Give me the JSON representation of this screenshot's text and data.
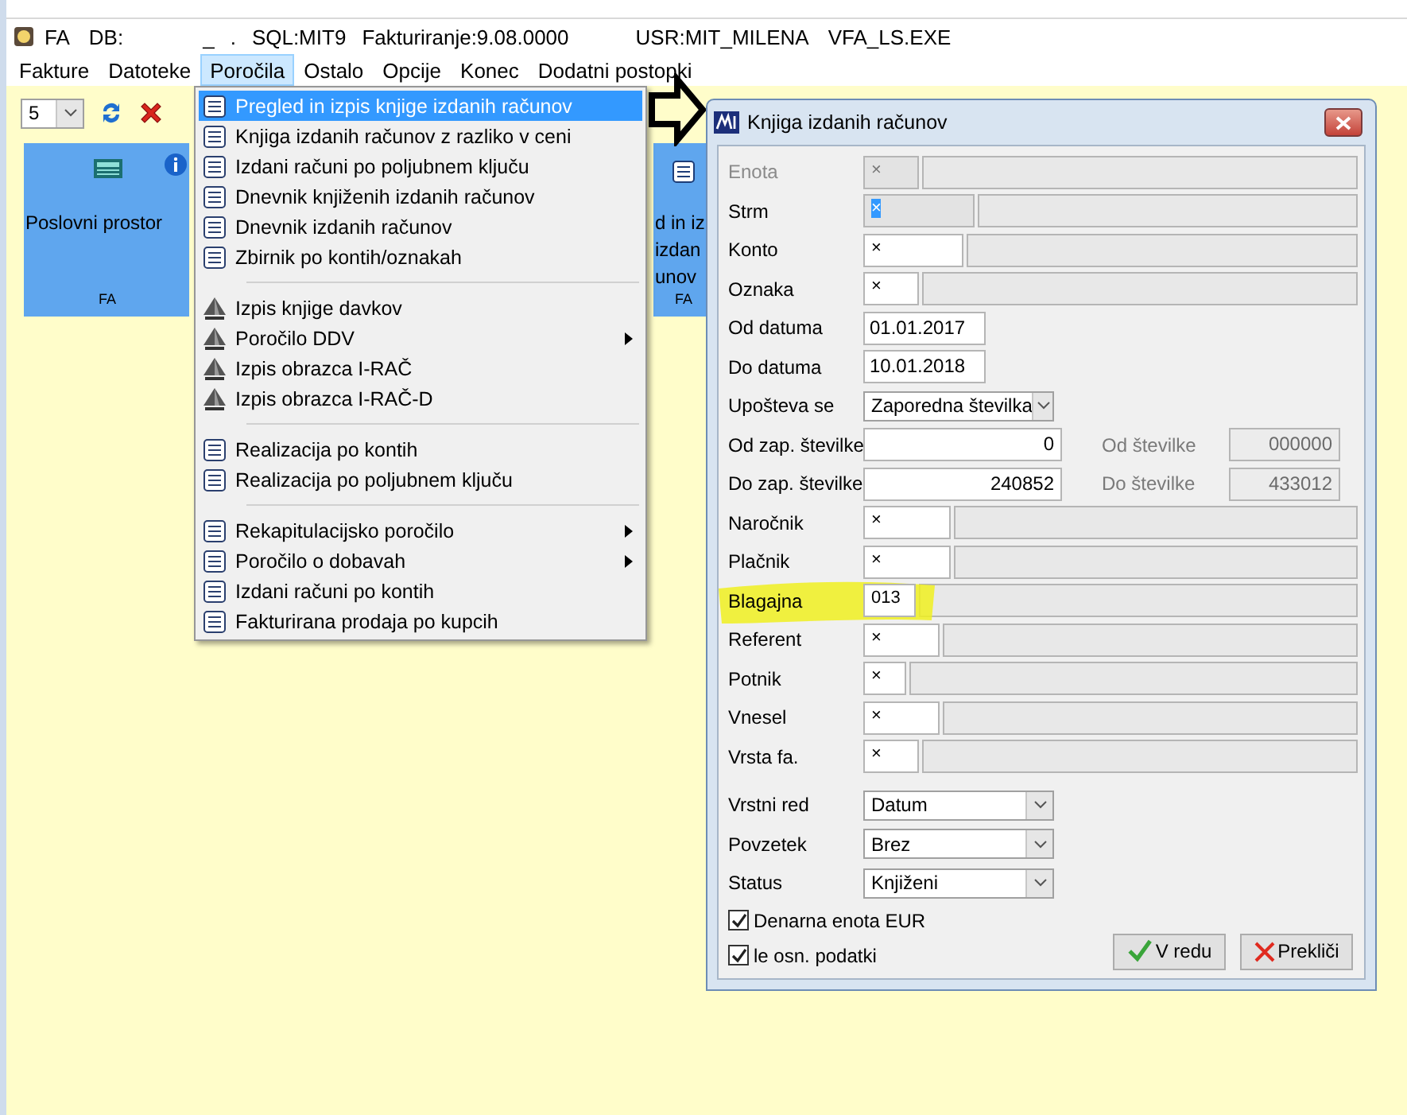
{
  "app_title": {
    "items": [
      "FA",
      "DB:",
      "_",
      ".",
      "SQL:MIT9",
      "Fakturiranje:9.08.0000",
      "USR:MIT_MILENA",
      "VFA_LS.EXE"
    ]
  },
  "menu_bar": [
    {
      "label": "Fakture",
      "selected": false
    },
    {
      "label": "Datoteke",
      "selected": false
    },
    {
      "label": "Poročila",
      "selected": true
    },
    {
      "label": "Ostalo",
      "selected": false
    },
    {
      "label": "Opcije",
      "selected": false
    },
    {
      "label": "Konec",
      "selected": false
    },
    {
      "label": "Dodatni postopki",
      "selected": false
    }
  ],
  "toolbar": {
    "count_select": "5"
  },
  "tiles": [
    {
      "title_lines": [
        "Poslovni prostor"
      ],
      "code": "FA",
      "kind": "calculator"
    },
    {
      "title_lines": [
        "d in iz",
        "izdan",
        "unov"
      ],
      "code": "FA",
      "kind": "report"
    }
  ],
  "dropdown_menu": {
    "groups": [
      [
        {
          "label": "Pregled in izpis knjige izdanih računov",
          "kind": "report",
          "submenu": false,
          "selected": true
        },
        {
          "label": "Knjiga izdanih računov z razliko v ceni",
          "kind": "report",
          "submenu": false,
          "selected": false
        },
        {
          "label": "Izdani računi po poljubnem ključu",
          "kind": "report",
          "submenu": false,
          "selected": false
        },
        {
          "label": "Dnevnik knjiženih izdanih računov",
          "kind": "report",
          "submenu": false,
          "selected": false
        },
        {
          "label": "Dnevnik izdanih računov",
          "kind": "report",
          "submenu": false,
          "selected": false
        },
        {
          "label": "Zbirnik po kontih/oznakah",
          "kind": "report",
          "submenu": false,
          "selected": false
        }
      ],
      [
        {
          "label": "Izpis knjige davkov",
          "kind": "tax",
          "submenu": false,
          "selected": false
        },
        {
          "label": "Poročilo DDV",
          "kind": "tax",
          "submenu": true,
          "selected": false
        },
        {
          "label": "Izpis obrazca I-RAČ",
          "kind": "tax",
          "submenu": false,
          "selected": false
        },
        {
          "label": "Izpis obrazca I-RAČ-D",
          "kind": "tax",
          "submenu": false,
          "selected": false
        }
      ],
      [
        {
          "label": "Realizacija po kontih",
          "kind": "report",
          "submenu": false,
          "selected": false
        },
        {
          "label": "Realizacija po poljubnem ključu",
          "kind": "report",
          "submenu": false,
          "selected": false
        }
      ],
      [
        {
          "label": "Rekapitulacijsko poročilo",
          "kind": "report",
          "submenu": true,
          "selected": false
        },
        {
          "label": "Poročilo o dobavah",
          "kind": "report",
          "submenu": true,
          "selected": false
        },
        {
          "label": "Izdani računi po kontih",
          "kind": "report",
          "submenu": false,
          "selected": false
        },
        {
          "label": "Fakturirana prodaja po kupcih",
          "kind": "report",
          "submenu": false,
          "selected": false
        }
      ]
    ]
  },
  "dialog": {
    "title": "Knjiga izdanih računov",
    "fields": [
      {
        "kind": "lookup",
        "label": "Enota",
        "value": "×",
        "disabled": true,
        "text_selected": false,
        "highlighted": false
      },
      {
        "kind": "lookup",
        "label": "Strm",
        "value": "×",
        "disabled": false,
        "text_selected": true,
        "highlighted": false
      },
      {
        "kind": "lookup",
        "label": "Konto",
        "value": "×",
        "disabled": false,
        "text_selected": false,
        "highlighted": false
      },
      {
        "kind": "lookup",
        "label": "Oznaka",
        "value": "×",
        "disabled": false,
        "text_selected": false,
        "highlighted": false
      },
      {
        "kind": "text",
        "label": "Od datuma",
        "value": "01.01.2017"
      },
      {
        "kind": "text",
        "label": "Do datuma",
        "value": "10.01.2018"
      },
      {
        "kind": "combo",
        "label": "Upošteva se",
        "value": "Zaporedna številka"
      },
      {
        "kind": "number",
        "label": "Od zap. številke",
        "value": "0",
        "side_label": "Od številke",
        "side_value": "000000"
      },
      {
        "kind": "number",
        "label": "Do zap. številke",
        "value": "240852",
        "side_label": "Do številke",
        "side_value": "433012"
      },
      {
        "kind": "lookup",
        "label": "Naročnik",
        "value": "×",
        "disabled": false,
        "text_selected": false,
        "highlighted": false
      },
      {
        "kind": "lookup",
        "label": "Plačnik",
        "value": "×",
        "disabled": false,
        "text_selected": false,
        "highlighted": false
      },
      {
        "kind": "lookup",
        "label": "Blagajna",
        "value": "013",
        "disabled": false,
        "text_selected": false,
        "highlighted": true
      },
      {
        "kind": "lookup",
        "label": "Referent",
        "value": "×",
        "disabled": false,
        "text_selected": false,
        "highlighted": false
      },
      {
        "kind": "lookup",
        "label": "Potnik",
        "value": "×",
        "disabled": false,
        "text_selected": false,
        "highlighted": false
      },
      {
        "kind": "lookup",
        "label": "Vnesel",
        "value": "×",
        "disabled": false,
        "text_selected": false,
        "highlighted": false
      },
      {
        "kind": "lookup",
        "label": "Vrsta fa.",
        "value": "×",
        "disabled": false,
        "text_selected": false,
        "highlighted": false
      },
      {
        "kind": "combo",
        "label": "Vrstni red",
        "value": "Datum"
      },
      {
        "kind": "combo",
        "label": "Povzetek",
        "value": "Brez"
      },
      {
        "kind": "combo",
        "label": "Status",
        "value": "Knjiženi"
      }
    ],
    "checkboxes": [
      {
        "label": "Denarna enota EUR",
        "checked": true
      },
      {
        "label": "le osn. podatki",
        "checked": true
      }
    ],
    "buttons": [
      {
        "label": "V redu",
        "kind": "ok"
      },
      {
        "label": "Prekliči",
        "kind": "cancel"
      }
    ]
  }
}
